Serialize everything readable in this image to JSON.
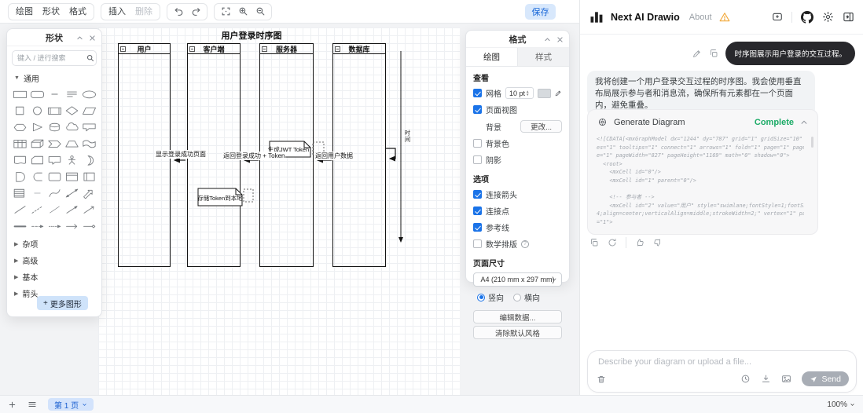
{
  "toolbar": {
    "menu_draw": "绘图",
    "menu_shape": "形状",
    "menu_format": "格式",
    "insert": "插入",
    "delete": "删除",
    "save": "保存"
  },
  "shapes_panel": {
    "title": "形状",
    "search_placeholder": "键入 / 进行搜索",
    "section_general": "通用",
    "sections": [
      "杂项",
      "高级",
      "基本",
      "箭头"
    ],
    "more_shapes": "更多图形",
    "grid": [
      "rectangle",
      "rounded-rectangle",
      "text",
      "list",
      "ellipse",
      "square",
      "circle",
      "process",
      "diamond",
      "parallelogram",
      "hexagon",
      "triangle",
      "cylinder",
      "cloud",
      "callout",
      "table",
      "cube",
      "step",
      "trapezoid",
      "tape",
      "document",
      "card",
      "bubble",
      "actor",
      "or",
      "and",
      "delay",
      "container",
      "internal-storage",
      "frame",
      "form",
      "dash",
      "curve",
      "two-way-arrow",
      "thick-arrow",
      "line",
      "dashed-line",
      "diagonal-line",
      "directional-arrow",
      "thin-arrow",
      "bold-link",
      "dashed-arrow",
      "dashed-arrow-2",
      "open-arrow",
      "diamond-link"
    ]
  },
  "format_panel": {
    "title": "格式",
    "tab_draw": "绘图",
    "tab_style": "样式",
    "section_view": "查看",
    "grid_label": "网格",
    "grid_size": "10 pt",
    "page_view": "页面视图",
    "background_label": "背景",
    "change_button": "更改...",
    "background_color": "背景色",
    "shadow": "阴影",
    "section_options": "选项",
    "connection_arrows": "连接箭头",
    "connection_points": "连接点",
    "guides": "参考线",
    "math": "数学排版",
    "section_page_size": "页面尺寸",
    "paper": "A4 (210 mm x 297 mm)",
    "portrait": "竖向",
    "landscape": "横向",
    "edit_data": "编辑数据...",
    "clear_default_style": "清除默认风格"
  },
  "canvas": {
    "title": "用户登录时序图",
    "lanes": [
      "用户",
      "客户端",
      "服务器",
      "数据库"
    ],
    "messages": [
      "显示登录成功页面",
      "返回登录成功 + Token",
      "返回用户数据"
    ],
    "notes": [
      "生成JWT Token",
      "存储Token到本地"
    ],
    "time_label": "时间"
  },
  "bottom_bar": {
    "page": "第 1 页",
    "zoom": "100%"
  },
  "chat": {
    "app_name": "Next AI Drawio",
    "about": "About",
    "user_message": "时序图展示用户登录的交互过程。",
    "assistant_message": "我将创建一个用户登录交互过程的时序图。我会使用垂直布局展示参与者和消息流，确保所有元素都在一个页面内，避免重叠。",
    "tool_title": "Generate Diagram",
    "tool_status": "Complete",
    "code": "<![CDATA[<mxGraphModel dx=\"1244\" dy=\"787\" grid=\"1\" gridSize=\"10\" guid\nes=\"1\" tooltips=\"1\" connect=\"1\" arrows=\"1\" fold=\"1\" page=\"1\" pageScal\ne=\"1\" pageWidth=\"827\" pageHeight=\"1169\" math=\"0\" shadow=\"0\">\n  <root>\n    <mxCell id=\"0\"/>\n    <mxCell id=\"1\" parent=\"0\"/>\n\n    <!-- 参与者 -->\n    <mxCell id=\"2\" value=\"用户\" style=\"swimlane;fontStyle=1;fontSize=2\n4;align=center;verticalAlign=middle;strokeWidth=2;\" vertex=\"1\" parent\n=\"1\">",
    "input_placeholder": "Describe your diagram or upload a file...",
    "send": "Send"
  },
  "colors": {
    "accent_blue": "#1a73e8",
    "save_button_bg": "#d8e8fc",
    "complete_green": "#1cab67",
    "warning_orange": "#f2a93b",
    "user_bubble": "#28282c"
  }
}
